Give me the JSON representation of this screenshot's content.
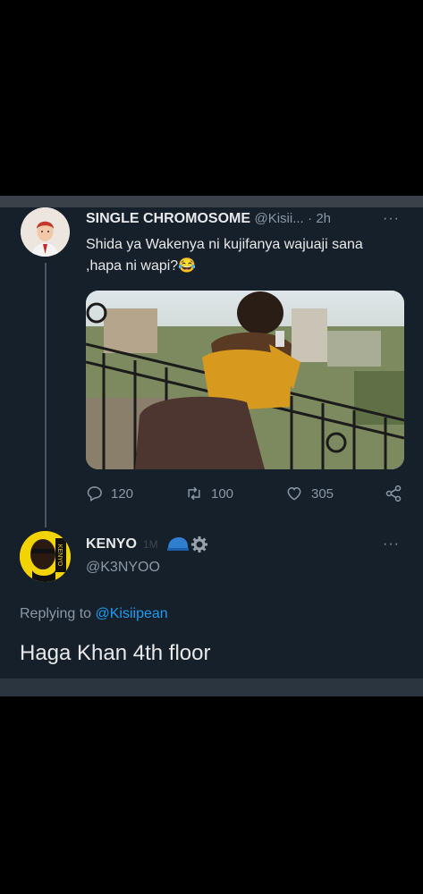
{
  "tweet": {
    "author_name": "SINGLE CHROMOSOME",
    "author_handle": "@Kisii...",
    "time": "· 2h",
    "more": "···",
    "text_line1": "Shida ya Wakenya ni kujifanya wajuaji sana",
    "text_line2": ",hapa ni wapi?",
    "emoji": "😂",
    "replies": "120",
    "retweets": "100",
    "likes": "305"
  },
  "reply": {
    "author_name": "KENYO",
    "badge_text": "1M",
    "author_handle": "@K3NYOO",
    "more": "···",
    "replying_label": "Replying to ",
    "replying_handle": "@Kisiipean",
    "text": "Haga Khan 4th floor"
  },
  "colors": {
    "background": "#15202b",
    "text": "#e7e9ea",
    "secondary": "#8b98a5",
    "link": "#1d9bf0"
  },
  "icons": [
    "reply-icon",
    "retweet-icon",
    "like-icon",
    "share-icon",
    "helmet-icon",
    "gear-icon",
    "more-icon"
  ]
}
